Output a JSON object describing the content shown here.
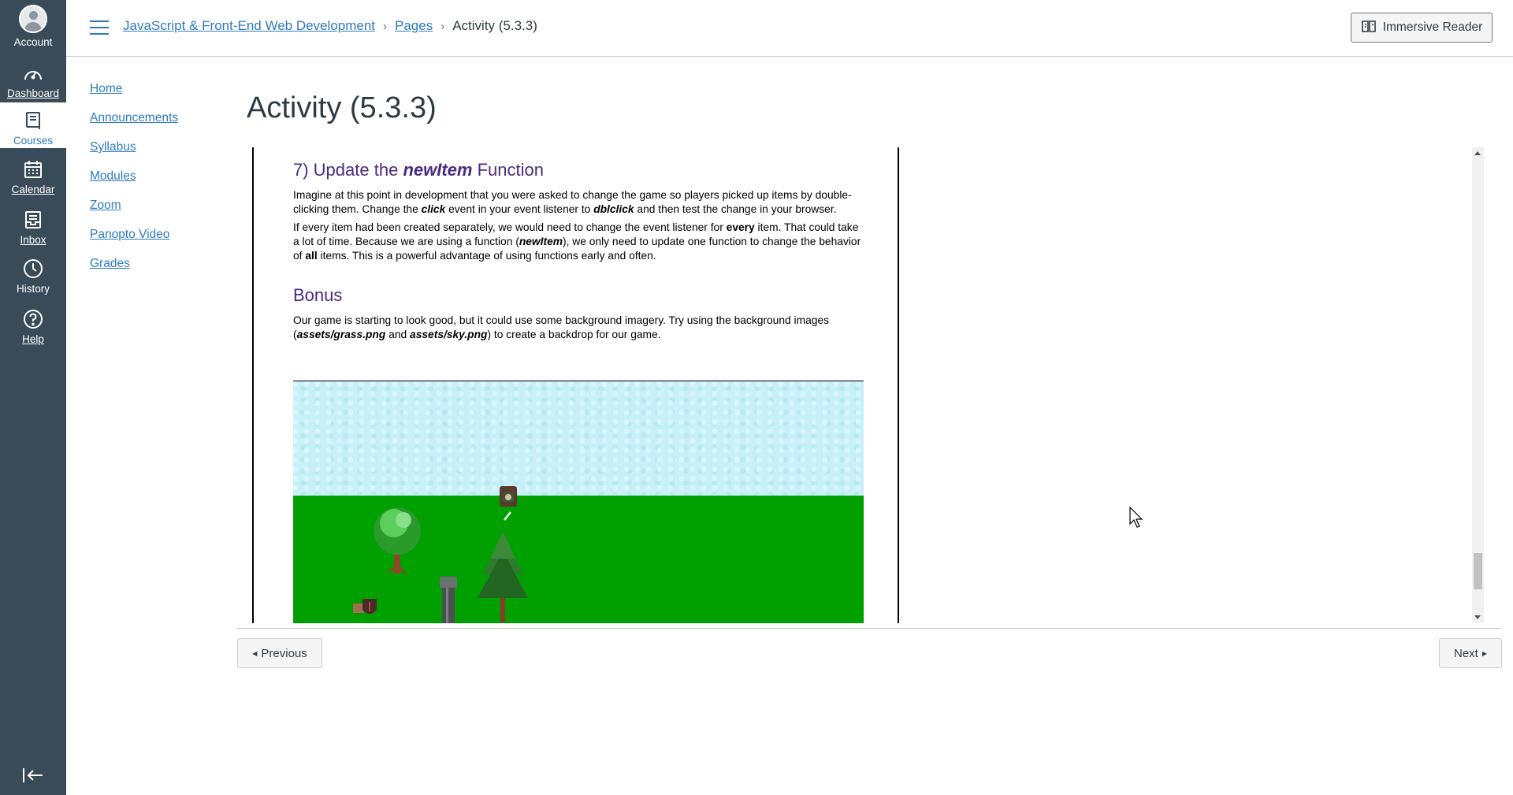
{
  "global_nav": {
    "account": "Account",
    "dashboard": "Dashboard",
    "courses": "Courses",
    "calendar": "Calendar",
    "inbox": "Inbox",
    "history": "History",
    "help": "Help"
  },
  "breadcrumb": {
    "course": "JavaScript & Front-End Web Development",
    "pages": "Pages",
    "current": "Activity (5.3.3)"
  },
  "header": {
    "immersive_reader": "Immersive Reader"
  },
  "course_nav": [
    "Home",
    "Announcements",
    "Syllabus",
    "Modules",
    "Zoom",
    "Panopto Video",
    "Grades"
  ],
  "page": {
    "title": "Activity (5.3.3)"
  },
  "doc": {
    "h_update_prefix": "7) Update the ",
    "h_update_em": "newItem",
    "h_update_suffix": " Function",
    "p1_a": "Imagine at this point in development that you were asked to change the game so players picked up items by double-clicking them. Change the ",
    "p1_click": "click",
    "p1_b": " event in your event listener to ",
    "p1_dbl": "dblclick",
    "p1_c": " and then test the change in your browser.",
    "p2_a": "If every item had been created separately, we would need to change the event listener for ",
    "p2_every": "every",
    "p2_b": " item. That could take a lot of time. Because we are using a function (",
    "p2_fn": "newItem",
    "p2_c": "), we only need to update one function to change the behavior of ",
    "p2_all": "all",
    "p2_d": " items. This is a powerful advantage of using functions early and often.",
    "h_bonus": "Bonus",
    "p3_a": "Our game is starting to look good, but it could use some background imagery. Try using the background images (",
    "p3_grass": "assets/grass.png",
    "p3_b": " and ",
    "p3_sky": "assets/sky.png",
    "p3_c": ") to create a backdrop for our game."
  },
  "footer": {
    "previous": "Previous",
    "next": "Next"
  },
  "colors": {
    "nav_bg": "#394b58",
    "link": "#2d7abf",
    "heading_purple": "#4b2a83",
    "grass": "#00a000",
    "sky": "#c8f0f8"
  }
}
